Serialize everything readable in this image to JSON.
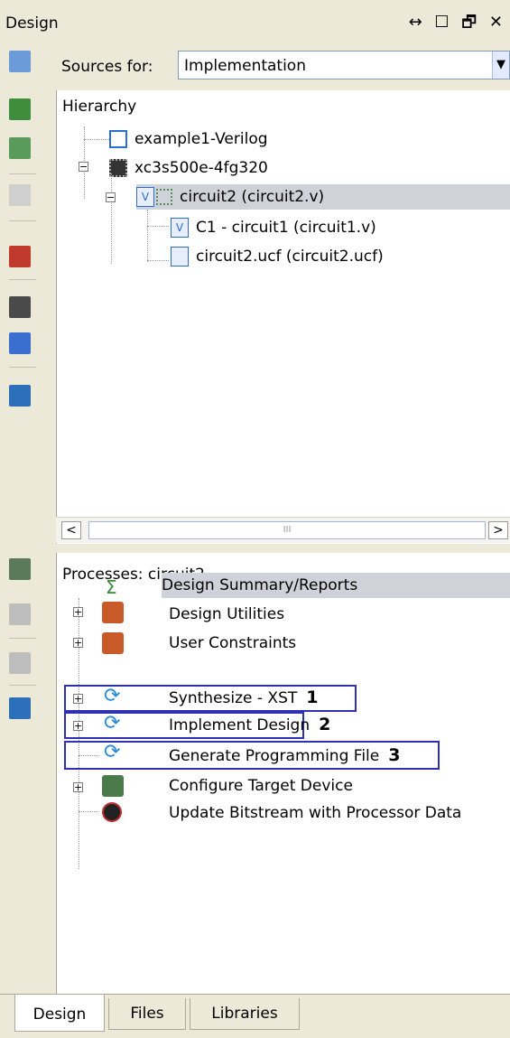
{
  "window": {
    "title": "Design",
    "controls": "↔ ☐ 🗗 ✕"
  },
  "sources": {
    "label": "Sources for:",
    "value": "Implementation"
  },
  "hierarchy": {
    "header": "Hierarchy",
    "items": [
      {
        "label": "example1-Verilog"
      },
      {
        "label": "xc3s500e-4fg320"
      },
      {
        "label": "circuit2 (circuit2.v)"
      },
      {
        "label": "C1 - circuit1 (circuit1.v)"
      },
      {
        "label": "circuit2.ucf (circuit2.ucf)"
      }
    ]
  },
  "scroll": {
    "left": "<",
    "right": ">",
    "thumb": "III"
  },
  "processes": {
    "header": "Processes: circuit2",
    "items": [
      {
        "label": "Design Summary/Reports"
      },
      {
        "label": "Design Utilities"
      },
      {
        "label": "User Constraints"
      },
      {
        "label": "Synthesize - XST",
        "marker": "1"
      },
      {
        "label": "Implement Design",
        "marker": "2"
      },
      {
        "label": "Generate Programming File",
        "marker": "3"
      },
      {
        "label": "Configure Target Device"
      },
      {
        "label": "Update Bitstream with Processor Data"
      }
    ]
  },
  "tabs": [
    "Design",
    "Files",
    "Libraries"
  ],
  "colors": {
    "accent_box": "#2f2fb4",
    "selection": "#cfd2d9",
    "panel_bg": "#ece9d8"
  }
}
